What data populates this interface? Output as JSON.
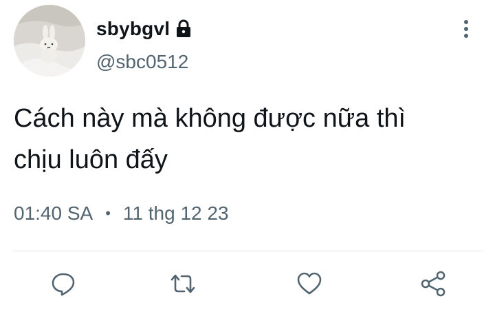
{
  "author": {
    "display_name": "sbybgvl",
    "handle": "@sbc0512",
    "avatar_icon": "plush-bunny-avatar",
    "protected_icon": "lock-icon"
  },
  "tweet": {
    "text_lines": [
      "Cách này mà không được nữa thì",
      "chịu luôn đấy"
    ],
    "time": "01:40 SA",
    "separator": "•",
    "date": "11 thg 12 23"
  },
  "actions": {
    "reply_icon": "reply-icon",
    "retweet_icon": "retweet-icon",
    "like_icon": "heart-icon",
    "share_icon": "share-icon",
    "more_icon": "more-vertical-icon"
  },
  "colors": {
    "text": "#0f1419",
    "secondary": "#536471",
    "icon": "#536471",
    "divider": "#e3e6e8"
  }
}
